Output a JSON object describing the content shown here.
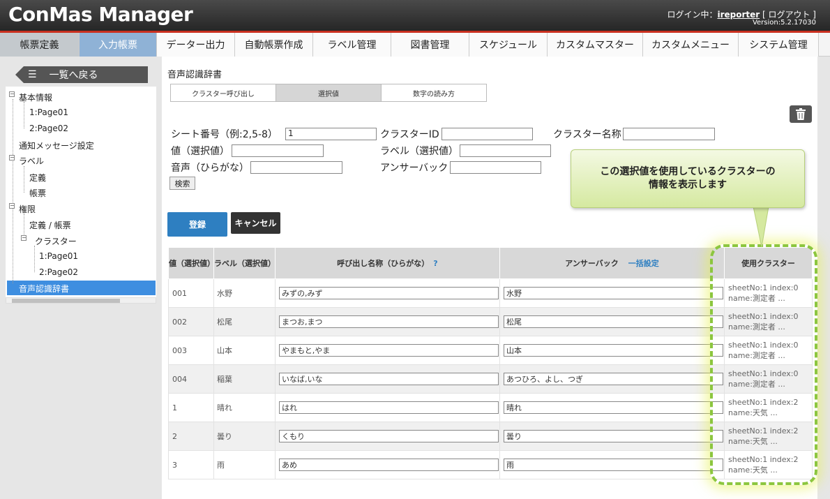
{
  "header": {
    "app_title": "ConMas Manager",
    "login_prefix": "ログイン中：",
    "user": "ireporter",
    "logout": "[ ログアウト ]",
    "version": "Version:5.2.17030"
  },
  "nav": [
    {
      "label": "帳票定義"
    },
    {
      "label": "入力帳票"
    },
    {
      "label": "データー出力"
    },
    {
      "label": "自動帳票作成"
    },
    {
      "label": "ラベル管理"
    },
    {
      "label": "図書管理"
    },
    {
      "label": "スケジュール"
    },
    {
      "label": "カスタムマスター"
    },
    {
      "label": "カスタムメニュー"
    },
    {
      "label": "システム管理"
    }
  ],
  "sidebar": {
    "back_label": "一覧へ戻る",
    "tree": {
      "basic_info": "基本情報",
      "basic_page1": "1:Page01",
      "basic_page2": "2:Page02",
      "notice": "通知メッセージ設定",
      "label": "ラベル",
      "label_def": "定義",
      "label_form": "帳票",
      "perm": "権限",
      "perm_def": "定義 / 帳票",
      "cluster": "クラスター",
      "cluster_page1": "1:Page01",
      "cluster_page2": "2:Page02",
      "voice_dict": "音声認識辞書"
    }
  },
  "main": {
    "page_title": "音声認識辞書",
    "subtabs": [
      "クラスター呼び出し",
      "選択値",
      "数字の読み方"
    ],
    "search": {
      "sheet_label": "シート番号（例:2,5-8）",
      "sheet_value": "1",
      "cluster_id_label": "クラスターID",
      "cluster_name_label": "クラスター名称",
      "value_label": "値（選択値）",
      "label_label": "ラベル（選択値）",
      "voice_label": "音声（ひらがな）",
      "answer_label": "アンサーバック",
      "search_btn": "検索"
    },
    "register_btn": "登録",
    "cancel_btn": "キャンセル",
    "table": {
      "headers": {
        "value": "値（選択値）",
        "label": "ラベル（選択値）",
        "call_name": "呼び出し名称（ひらがな）",
        "help": "?",
        "answer": "アンサーバック",
        "bulk": "一括設定",
        "cluster": "使用クラスター"
      },
      "rows": [
        {
          "value": "001",
          "label": "水野",
          "call": "みずの,みず",
          "answer": "水野",
          "c1": "sheetNo:1 index:0",
          "c2": "name:測定者 ..."
        },
        {
          "value": "002",
          "label": "松尾",
          "call": "まつお,まつ",
          "answer": "松尾",
          "c1": "sheetNo:1 index:0",
          "c2": "name:測定者 ..."
        },
        {
          "value": "003",
          "label": "山本",
          "call": "やまもと,やま",
          "answer": "山本",
          "c1": "sheetNo:1 index:0",
          "c2": "name:測定者 ..."
        },
        {
          "value": "004",
          "label": "稲葉",
          "call": "いなば,いな",
          "answer": "あつひろ、よし、つぎ",
          "c1": "sheetNo:1 index:0",
          "c2": "name:測定者 ..."
        },
        {
          "value": "1",
          "label": "晴れ",
          "call": "はれ",
          "answer": "晴れ",
          "c1": "sheetNo:1 index:2",
          "c2": "name:天気 ..."
        },
        {
          "value": "2",
          "label": "曇り",
          "call": "くもり",
          "answer": "曇り",
          "c1": "sheetNo:1 index:2",
          "c2": "name:天気 ..."
        },
        {
          "value": "3",
          "label": "雨",
          "call": "あめ",
          "answer": "雨",
          "c1": "sheetNo:1 index:2",
          "c2": "name:天気 ..."
        }
      ]
    }
  },
  "callout": {
    "line1": "この選択値を使用しているクラスターの",
    "line2": "情報を表示します"
  },
  "colors": {
    "accent_blue": "#2e7fc1",
    "header_red": "#c9301f",
    "callout_green": "#8cc63f"
  }
}
